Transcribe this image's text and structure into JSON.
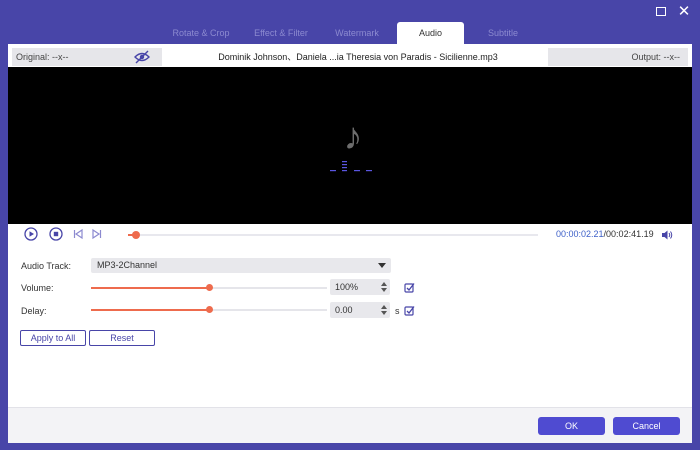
{
  "window": {
    "maximize_icon": "maximize-icon",
    "close_icon": "close-icon"
  },
  "tabs": [
    {
      "label": "Rotate & Crop",
      "active": false
    },
    {
      "label": "Effect & Filter",
      "active": false
    },
    {
      "label": "Watermark",
      "active": false
    },
    {
      "label": "Audio",
      "active": true
    },
    {
      "label": "Subtitle",
      "active": false
    }
  ],
  "preview": {
    "original_label": "Original: --x--",
    "output_label": "Output: --x--",
    "file_name": "Dominik Johnson、Daniela ...ia Theresia von Paradis - Sicilienne.mp3",
    "music_icon": "music-note-icon"
  },
  "playback": {
    "current_time": "00:00:02.21",
    "total_time": "/00:02:41.19",
    "progress_fraction": 0.02
  },
  "settings": {
    "audio_track_label": "Audio Track:",
    "audio_track_value": "MP3-2Channel",
    "volume_label": "Volume:",
    "volume_value": "100%",
    "volume_fraction": 0.5,
    "delay_label": "Delay:",
    "delay_value": "0.00",
    "delay_unit": "s",
    "delay_fraction": 0.5
  },
  "actions": {
    "apply_all_label": "Apply to All",
    "reset_label": "Reset",
    "ok_label": "OK",
    "cancel_label": "Cancel"
  },
  "colors": {
    "brand": "#4845a8",
    "primary_button": "#4f4bd1",
    "accent": "#ee6b4d",
    "time_highlight": "#3c5fc8"
  }
}
